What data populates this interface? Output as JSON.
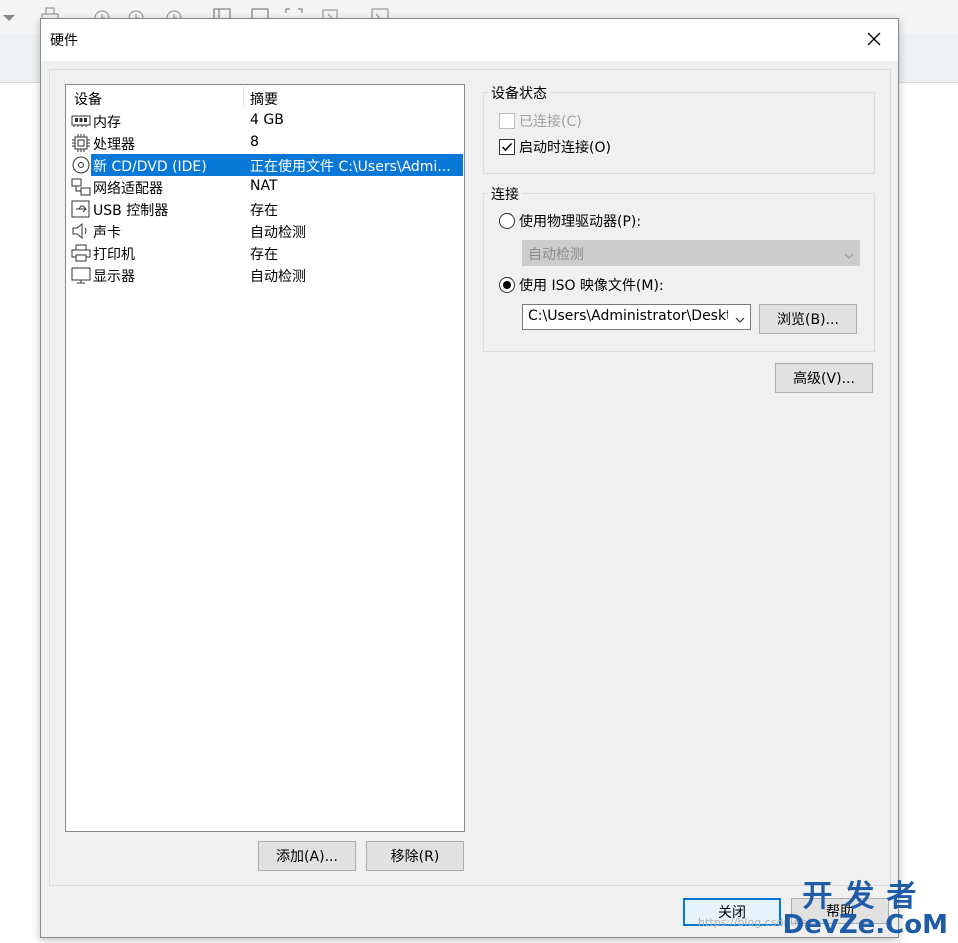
{
  "dialog": {
    "title": "硬件"
  },
  "devices": {
    "headers": {
      "device": "设备",
      "summary": "摘要"
    },
    "rows": [
      {
        "icon": "memory-icon",
        "name": "内存",
        "summary": "4 GB"
      },
      {
        "icon": "processor-icon",
        "name": "处理器",
        "summary": "8"
      },
      {
        "icon": "cd-dvd-icon",
        "name": "新 CD/DVD (IDE)",
        "summary": "正在使用文件 C:\\Users\\Admi..."
      },
      {
        "icon": "network-adapter-icon",
        "name": "网络适配器",
        "summary": "NAT"
      },
      {
        "icon": "usb-icon",
        "name": "USB 控制器",
        "summary": "存在"
      },
      {
        "icon": "sound-card-icon",
        "name": "声卡",
        "summary": "自动检测"
      },
      {
        "icon": "printer-icon",
        "name": "打印机",
        "summary": "存在"
      },
      {
        "icon": "display-icon",
        "name": "显示器",
        "summary": "自动检测"
      }
    ],
    "selected_index": 2
  },
  "buttons": {
    "add": "添加(A)...",
    "remove": "移除(R)",
    "close": "关闭",
    "help": "帮助"
  },
  "device_status": {
    "group_label": "设备状态",
    "connected_label": "已连接(C)",
    "connected_checked": false,
    "connected_enabled": false,
    "connect_at_power_on_label": "启动时连接(O)",
    "connect_at_power_on_checked": true
  },
  "connection": {
    "group_label": "连接",
    "physical_drive_label": "使用物理驱动器(P):",
    "physical_drive_value": "自动检测",
    "iso_label": "使用 ISO 映像文件(M):",
    "iso_path": "C:\\Users\\Administrator\\Deskto",
    "browse_label": "浏览(B)...",
    "selected": "iso"
  },
  "advanced_label": "高级(V)...",
  "watermark": {
    "line1": "开发者",
    "line2": "DevZe.CoM",
    "url": "https://blog.csdn.net"
  }
}
